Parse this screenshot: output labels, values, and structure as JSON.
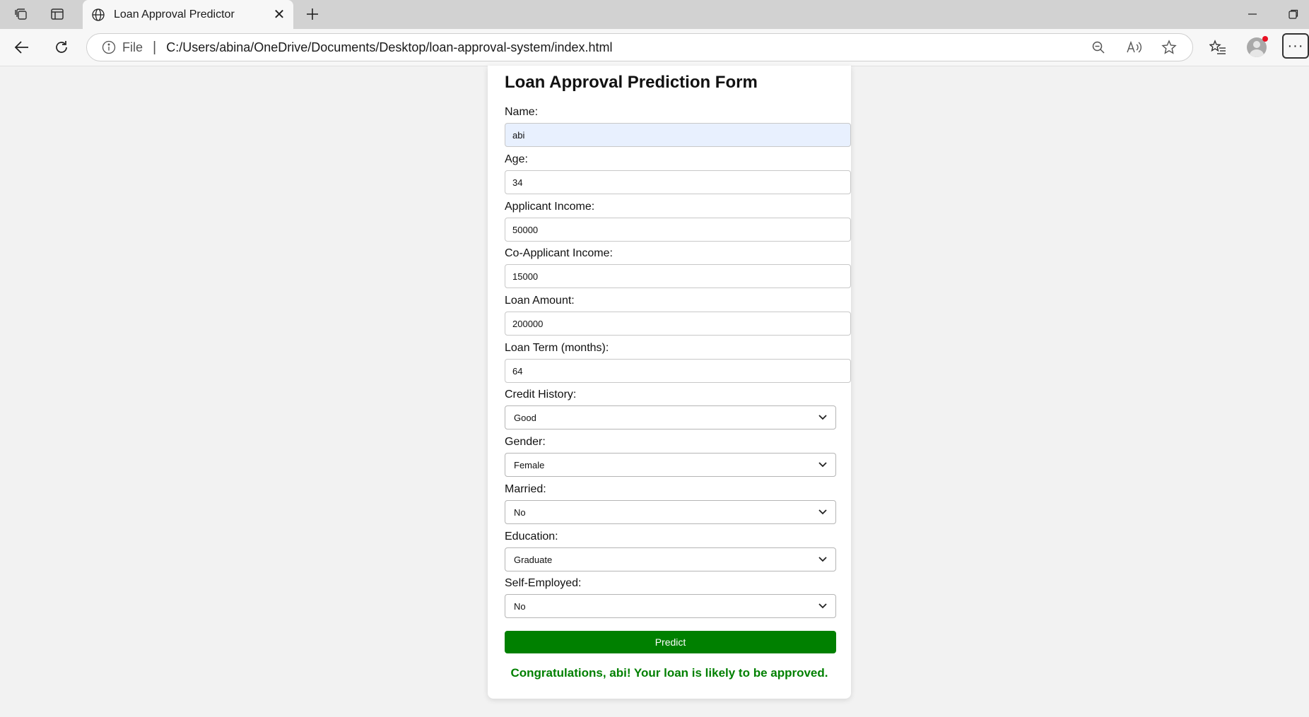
{
  "browser": {
    "tab_title": "Loan Approval Predictor",
    "address_scheme": "File",
    "address_separator": "|",
    "url": "C:/Users/abina/OneDrive/Documents/Desktop/loan-approval-system/index.html",
    "icons": [
      "collections-icon",
      "tab-actions-icon",
      "globe-icon",
      "close-icon",
      "plus-icon",
      "minimize-icon",
      "restore-icon",
      "back-icon",
      "refresh-icon",
      "info-icon",
      "zoom-out-icon",
      "read-aloud-icon",
      "favorite-star-icon",
      "favorites-list-icon",
      "profile-icon",
      "more-icon"
    ],
    "notification_color": "#e81123"
  },
  "form": {
    "title": "Loan Approval Prediction Form",
    "name_label": "Name:",
    "name_value": "abi",
    "age_label": "Age:",
    "age_value": "34",
    "income_label": "Applicant Income:",
    "income_value": "50000",
    "coincome_label": "Co-Applicant Income:",
    "coincome_value": "15000",
    "loan_amount_label": "Loan Amount:",
    "loan_amount_value": "200000",
    "loan_term_label": "Loan Term (months):",
    "loan_term_value": "64",
    "credit_label": "Credit History:",
    "credit_value": "Good",
    "gender_label": "Gender:",
    "gender_value": "Female",
    "married_label": "Married:",
    "married_value": "No",
    "education_label": "Education:",
    "education_value": "Graduate",
    "self_employed_label": "Self-Employed:",
    "self_employed_value": "No",
    "predict_label": "Predict",
    "result": "Congratulations, abi! Your loan is likely to be approved.",
    "accent_color": "#008000",
    "autofill_color": "#e8f0fe"
  }
}
